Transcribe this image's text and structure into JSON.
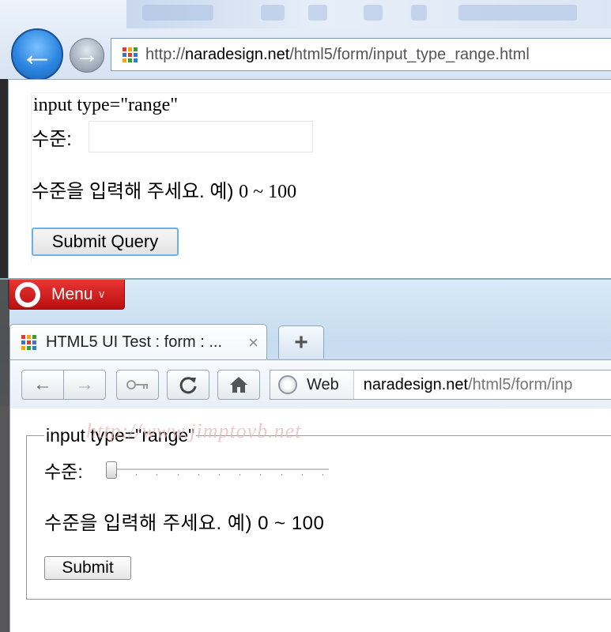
{
  "colors": {
    "ie_accent": "#2b86e0",
    "opera_red": "#cc1b1b",
    "focus_border": "#6cb2e8",
    "grid_icon": [
      "#e23b2e",
      "#f4a21b",
      "#3c9a3c",
      "#2f7ad6",
      "#e23b2e",
      "#2f7ad6",
      "#f4a21b",
      "#3c9a3c",
      "#2f7ad6"
    ]
  },
  "ie": {
    "back_icon": "arrow-left-icon",
    "forward_icon": "arrow-right-icon",
    "address": {
      "domain": "naradesign.net",
      "protocol": "http://",
      "path": "/html5/form/input_type_range.html"
    },
    "form": {
      "legend": "input type=\"range\"",
      "label": "수준:",
      "help_text": "수준을 입력해 주세요. 예) ",
      "help_range": "0 ~ 100",
      "submit_label": "Submit Query"
    }
  },
  "opera": {
    "menu_label": "Menu",
    "tab_title": "HTML5 UI Test : form : ...",
    "tab_close": "×",
    "new_tab": "+",
    "toolbar": {
      "back_icon": "arrow-left-icon",
      "forward_icon": "arrow-right-icon",
      "key_icon": "key-icon",
      "reload_icon": "reload-icon",
      "home_icon": "home-icon"
    },
    "address": {
      "web_label": "Web",
      "domain": "naradesign.net",
      "path": "/html5/form/inp"
    },
    "form": {
      "legend": "input type=\"range\"",
      "label": "수준:",
      "help_text": "수준을 입력해 주세요. 예) 0 ~ 100",
      "submit_label": "Submit",
      "range_value": 0,
      "range_min": 0,
      "range_max": 100,
      "range_ticks": 11
    },
    "watermark": "http://www.jimptovb.net"
  }
}
